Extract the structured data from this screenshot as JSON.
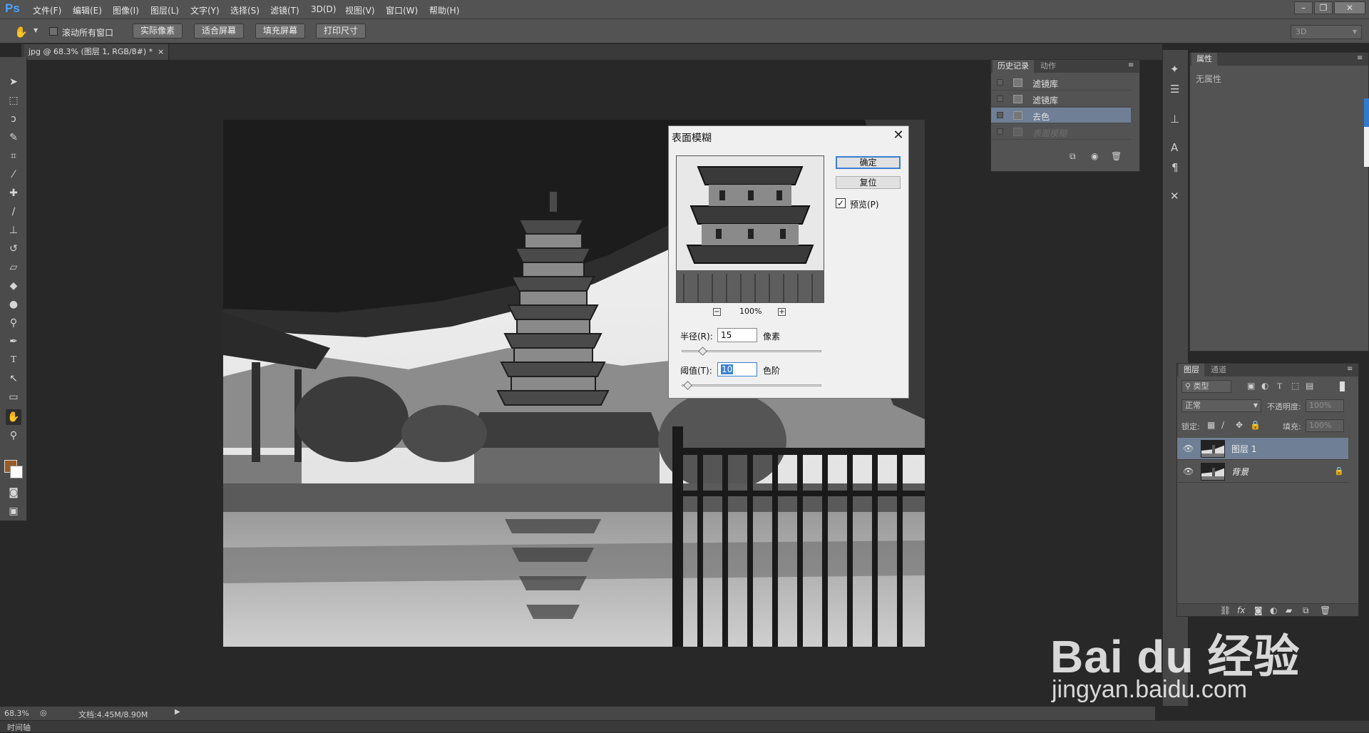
{
  "app": {
    "logo": "Ps"
  },
  "menu": [
    "文件(F)",
    "编辑(E)",
    "图像(I)",
    "图层(L)",
    "文字(Y)",
    "选择(S)",
    "滤镜(T)",
    "3D(D)",
    "视图(V)",
    "窗口(W)",
    "帮助(H)"
  ],
  "window_controls": {
    "minimize": "–",
    "restore": "❐",
    "close": "✕"
  },
  "options": {
    "scroll_all_windows": "滚动所有窗口",
    "scroll_all_checked": false,
    "buttons": [
      "实际像素",
      "适合屏幕",
      "填充屏幕",
      "打印尺寸"
    ],
    "workspace": "3D"
  },
  "document": {
    "tab_title": "jpg @ 68.3% (图层 1, RGB/8#) *"
  },
  "colors": {
    "foreground": "#9c5b23",
    "background": "#ffffff",
    "accent": "#3c7fd1"
  },
  "tools": [
    "move-icon",
    "marquee-icon",
    "lasso-icon",
    "quick-select-icon",
    "crop-icon",
    "eyedropper-icon",
    "healing-icon",
    "brush-icon",
    "stamp-icon",
    "history-brush-icon",
    "eraser-icon",
    "fill-icon",
    "blur-icon",
    "dodge-icon",
    "pen-icon",
    "type-icon",
    "path-select-icon",
    "shape-icon",
    "hand-icon",
    "zoom-icon"
  ],
  "dialog": {
    "title": "表面模糊",
    "ok": "确定",
    "reset": "复位",
    "preview_label": "预览(P)",
    "preview_checked": true,
    "zoom": "100%",
    "radius_label": "半径(R):",
    "radius_value": "15",
    "radius_unit": "像素",
    "radius_level": 0.15,
    "threshold_label": "阈值(T):",
    "threshold_value": "10",
    "threshold_unit": "色阶",
    "threshold_level": 0.04
  },
  "history_panel": {
    "tabs": [
      "历史记录",
      "动作"
    ],
    "items": [
      {
        "label": "滤镜库",
        "state": "normal"
      },
      {
        "label": "滤镜库",
        "state": "normal"
      },
      {
        "label": "去色",
        "state": "selected"
      },
      {
        "label": "表面模糊",
        "state": "dimmed"
      }
    ]
  },
  "properties_panel": {
    "tab": "属性",
    "empty_text": "无属性"
  },
  "layers_panel": {
    "tabs": [
      "图层",
      "通道"
    ],
    "filter_kind": "类型",
    "blend_mode": "正常",
    "opacity_label": "不透明度:",
    "opacity_value": "100%",
    "lock_label": "锁定:",
    "fill_label": "填充:",
    "fill_value": "100%",
    "layers": [
      {
        "name": "图层 1",
        "selected": true,
        "locked": false
      },
      {
        "name": "背景",
        "selected": false,
        "locked": true
      }
    ]
  },
  "status": {
    "zoom": "68.3%",
    "doc_info": "文档:4.45M/8.90M"
  },
  "timeline": {
    "label": "时间轴"
  },
  "watermark": {
    "brand": "Bai du 经验",
    "url": "jingyan.baidu.com"
  }
}
